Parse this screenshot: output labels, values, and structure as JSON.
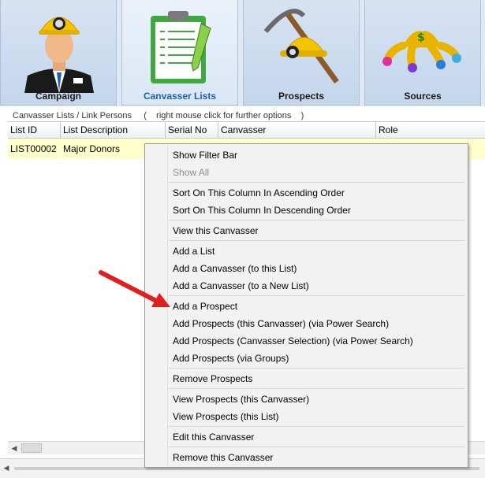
{
  "tabs": [
    {
      "label": "Campaign",
      "icon": "miner-person-icon",
      "active": false
    },
    {
      "label": "Canvasser Lists",
      "icon": "clipboard-pen-icon",
      "active": true
    },
    {
      "label": "Prospects",
      "icon": "hardhat-pickaxe-icon",
      "active": false
    },
    {
      "label": "Sources",
      "icon": "money-bag-icon",
      "active": false
    }
  ],
  "caption": "Canvasser Lists / Link Persons     (    right mouse click for further options    )",
  "grid": {
    "columns": [
      "List ID",
      "List Description",
      "Serial No",
      "Canvasser",
      "Role"
    ],
    "rows": [
      {
        "list_id": "LIST00002",
        "description": "Major Donors",
        "serial_no": "",
        "canvasser": "",
        "role": ""
      }
    ],
    "row_highlight": "#ffffcc"
  },
  "context_menu": {
    "items": [
      {
        "label": "Show Filter Bar",
        "enabled": true
      },
      {
        "label": "Show All",
        "enabled": false
      },
      {
        "label": "Sort On This Column In Ascending Order",
        "enabled": true
      },
      {
        "label": "Sort On This Column In Descending Order",
        "enabled": true
      },
      {
        "label": "View this Canvasser",
        "enabled": true
      },
      {
        "label": "Add a List",
        "enabled": true
      },
      {
        "label": "Add a Canvasser (to this List)",
        "enabled": true
      },
      {
        "label": "Add a Canvasser (to a New List)",
        "enabled": true
      },
      {
        "label": "Add a Prospect",
        "enabled": true
      },
      {
        "label": "Add Prospects (this Canvasser) (via Power Search)",
        "enabled": true
      },
      {
        "label": "Add Prospects (Canvasser Selection) (via Power Search)",
        "enabled": true
      },
      {
        "label": "Add Prospects (via Groups)",
        "enabled": true
      },
      {
        "label": "Remove Prospects",
        "enabled": true
      },
      {
        "label": "View Prospects (this Canvasser)",
        "enabled": true
      },
      {
        "label": "View Prospects (this List)",
        "enabled": true
      },
      {
        "label": "Edit this Canvasser",
        "enabled": true
      },
      {
        "label": "Remove this Canvasser",
        "enabled": true
      }
    ]
  },
  "annotation": {
    "icon": "red-arrow-icon",
    "color": "#e02020"
  },
  "colors": {
    "active_tab_text": "#1f5fb0",
    "tab_bg": "#c4d6ec"
  }
}
